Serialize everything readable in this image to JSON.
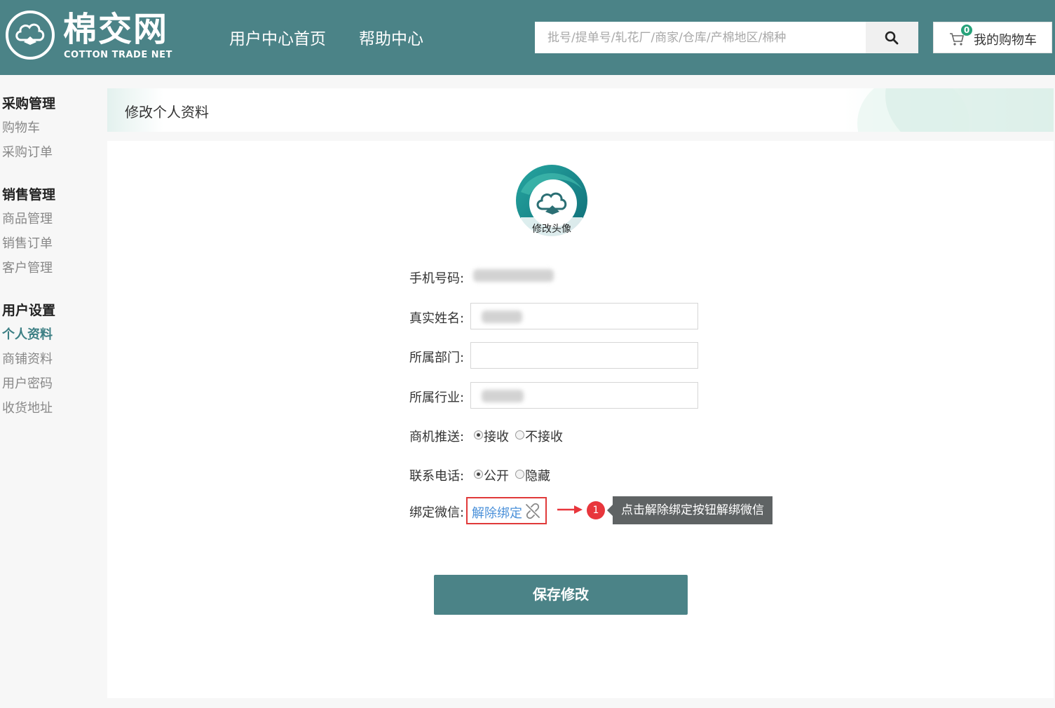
{
  "header": {
    "logo_main": "棉交网",
    "logo_sub": "COTTON TRADE NET",
    "nav": [
      {
        "label": "用户中心首页"
      },
      {
        "label": "帮助中心"
      }
    ],
    "search": {
      "placeholder": "批号/提单号/轧花厂/商家/仓库/产棉地区/棉种",
      "value": ""
    },
    "cart": {
      "count": "0",
      "label": "我的购物车"
    }
  },
  "sidebar": {
    "groups": [
      {
        "title": "采购管理",
        "items": [
          {
            "label": "购物车"
          },
          {
            "label": "采购订单"
          }
        ]
      },
      {
        "title": "销售管理",
        "items": [
          {
            "label": "商品管理"
          },
          {
            "label": "销售订单"
          },
          {
            "label": "客户管理"
          }
        ]
      },
      {
        "title": "用户设置",
        "items": [
          {
            "label": "个人资料"
          },
          {
            "label": "商铺资料"
          },
          {
            "label": "用户密码"
          },
          {
            "label": "收货地址"
          }
        ]
      }
    ],
    "active_item": "个人资料"
  },
  "main": {
    "page_title": "修改个人资料",
    "avatar_label": "修改头像",
    "form": {
      "phone_label": "手机号码:",
      "name_label": "真实姓名:",
      "department_label": "所属部门:",
      "industry_label": "所属行业:",
      "push_label": "商机推送:",
      "push_options": [
        "接收",
        "不接收"
      ],
      "push_selected": "接收",
      "contact_label": "联系电话:",
      "contact_options": [
        "公开",
        "隐藏"
      ],
      "contact_selected": "公开",
      "wechat_label": "绑定微信:",
      "unbind_label": "解除绑定"
    },
    "annotation": {
      "step": "1",
      "tooltip": "点击解除绑定按钮解绑微信"
    },
    "save_label": "保存修改"
  },
  "colors": {
    "brand": "#4b8387",
    "active_sidebar": "#3c7f84",
    "link": "#4a90d9",
    "highlight": "#e03a3a"
  }
}
